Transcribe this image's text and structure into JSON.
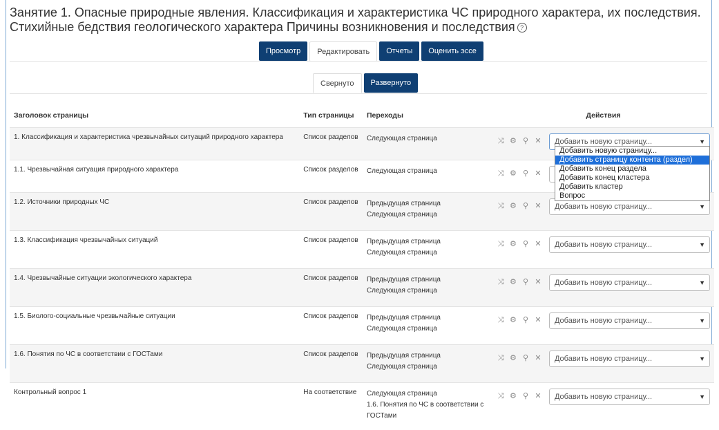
{
  "page": {
    "title_line1": "Занятие 1. Опасные природные явления. Классификация и характеристика ЧС природного характера, их последствия.",
    "title_line2": "Стихийные бедствия геологического характера Причины возникновения и последствия",
    "help_icon": "?"
  },
  "tabs": [
    "Просмотр",
    "Редактировать",
    "Отчеты",
    "Оценить эссе"
  ],
  "subtabs": [
    "Свернуто",
    "Развернуто"
  ],
  "table": {
    "headers": [
      "Заголовок страницы",
      "Тип страницы",
      "Переходы",
      "Действия"
    ],
    "select_placeholder": "Добавить новую страницу...",
    "rows": [
      {
        "title": "1. Классификация и характеристика чрезвычайных ситуаций природного характера",
        "type": "Список разделов",
        "t1": "Следующая страница",
        "t2": ""
      },
      {
        "title": "1.1. Чрезвычайная ситуация природного характера",
        "type": "Список разделов",
        "t1": "Следующая страница",
        "t2": ""
      },
      {
        "title": "1.2. Источники природных ЧС",
        "type": "Список разделов",
        "t1": "Предыдущая страница",
        "t2": "Следующая страница"
      },
      {
        "title": "1.3. Классификация чрезвычайных ситуаций",
        "type": "Список разделов",
        "t1": "Предыдущая страница",
        "t2": "Следующая страница"
      },
      {
        "title": "1.4. Чрезвычайные ситуации экологического характера",
        "type": "Список разделов",
        "t1": "Предыдущая страница",
        "t2": "Следующая страница"
      },
      {
        "title": "1.5. Биолого-социальные чрезвычайные ситуации",
        "type": "Список разделов",
        "t1": "Предыдущая страница",
        "t2": "Следующая страница"
      },
      {
        "title": "1.6. Понятия по ЧС в соответствии с ГОСТами",
        "type": "Список разделов",
        "t1": "Предыдущая страница",
        "t2": "Следующая страница"
      },
      {
        "title": "Контрольный вопрос 1",
        "type": "На соответствие",
        "t1": "Следующая страница",
        "t2": "1.6. Понятия по ЧС в соответствии с",
        "t3": "ГОСТами"
      }
    ]
  },
  "dropdown": {
    "options": [
      "Добавить новую страницу...",
      "Добавить страницу контента (раздел)",
      "Добавить конец раздела",
      "Добавить конец кластера",
      "Добавить кластер",
      "Вопрос"
    ],
    "highlighted": "Добавить страницу контента (раздел)"
  },
  "colors": {
    "tab_dark": "#0f3f73",
    "highlight": "#1e6fd9"
  },
  "icons": [
    "move-icon",
    "gear-icon",
    "preview-icon",
    "delete-icon"
  ]
}
